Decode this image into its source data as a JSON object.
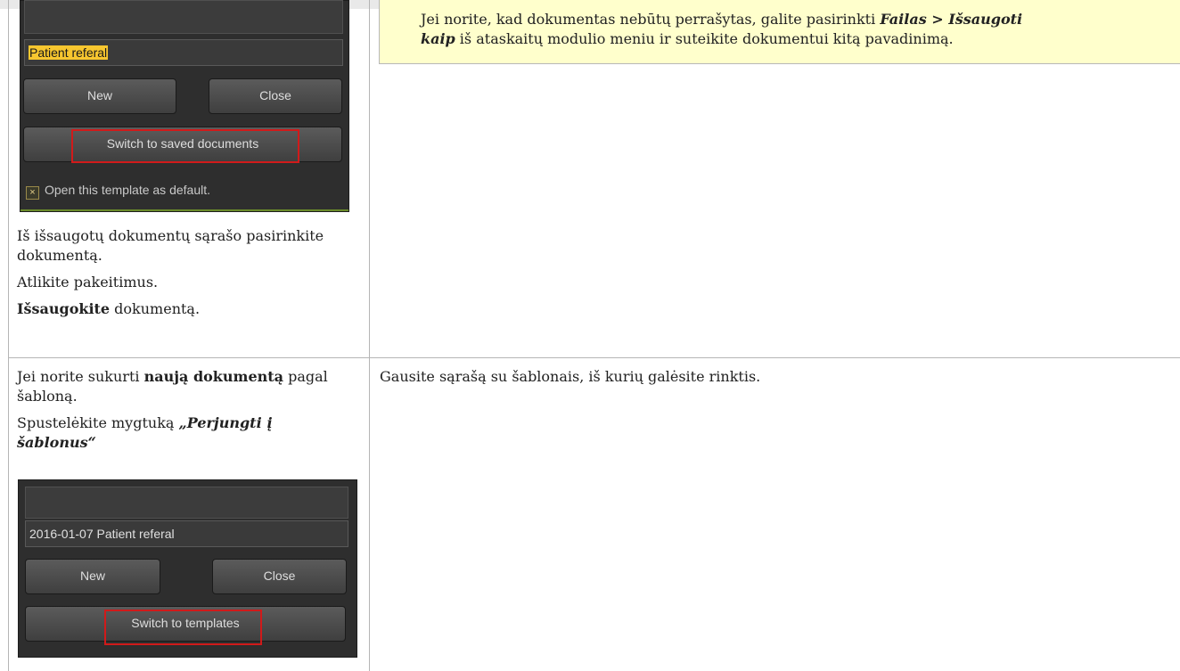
{
  "note": {
    "text_1": "Jei norite, kad dokumentas nebūtų perrašytas, galite pasirinkti ",
    "bold_1": "Failas",
    "text_2": " > ",
    "bold_2": "Išsaugoti",
    "bold_3": "kaip",
    "text_3": " iš ataskaitų modulio meniu ir suteikite dokumentui kitą pavadinimą."
  },
  "row1": {
    "panel": {
      "field_value": "Patient referal",
      "new_label": "New",
      "close_label": "Close",
      "switch_label": "Switch to saved documents",
      "checkbox_label": "Open this template as default.",
      "checkbox_mark": "×"
    },
    "step_1": "Iš išsaugotų dokumentų sąrašo pasirinkite dokumentą.",
    "step_2": "Atlikite pakeitimus.",
    "step_3_bold": "Išsaugokite",
    "step_3_rest": " dokumentą."
  },
  "row2": {
    "intro_text": "Jei norite sukurti ",
    "intro_bold": "naują dokumentą",
    "intro_rest": " pagal šabloną.",
    "click_text": "Spustelėkite mygtuką ",
    "click_bold": "„Perjungti į šablonus“",
    "result_text": "Gausite sąrašą su šablonais, iš kurių galėsite rinktis.",
    "panel": {
      "field_value": "2016-01-07 Patient referal",
      "new_label": "New",
      "close_label": "Close",
      "switch_label": "Switch to templates"
    }
  }
}
